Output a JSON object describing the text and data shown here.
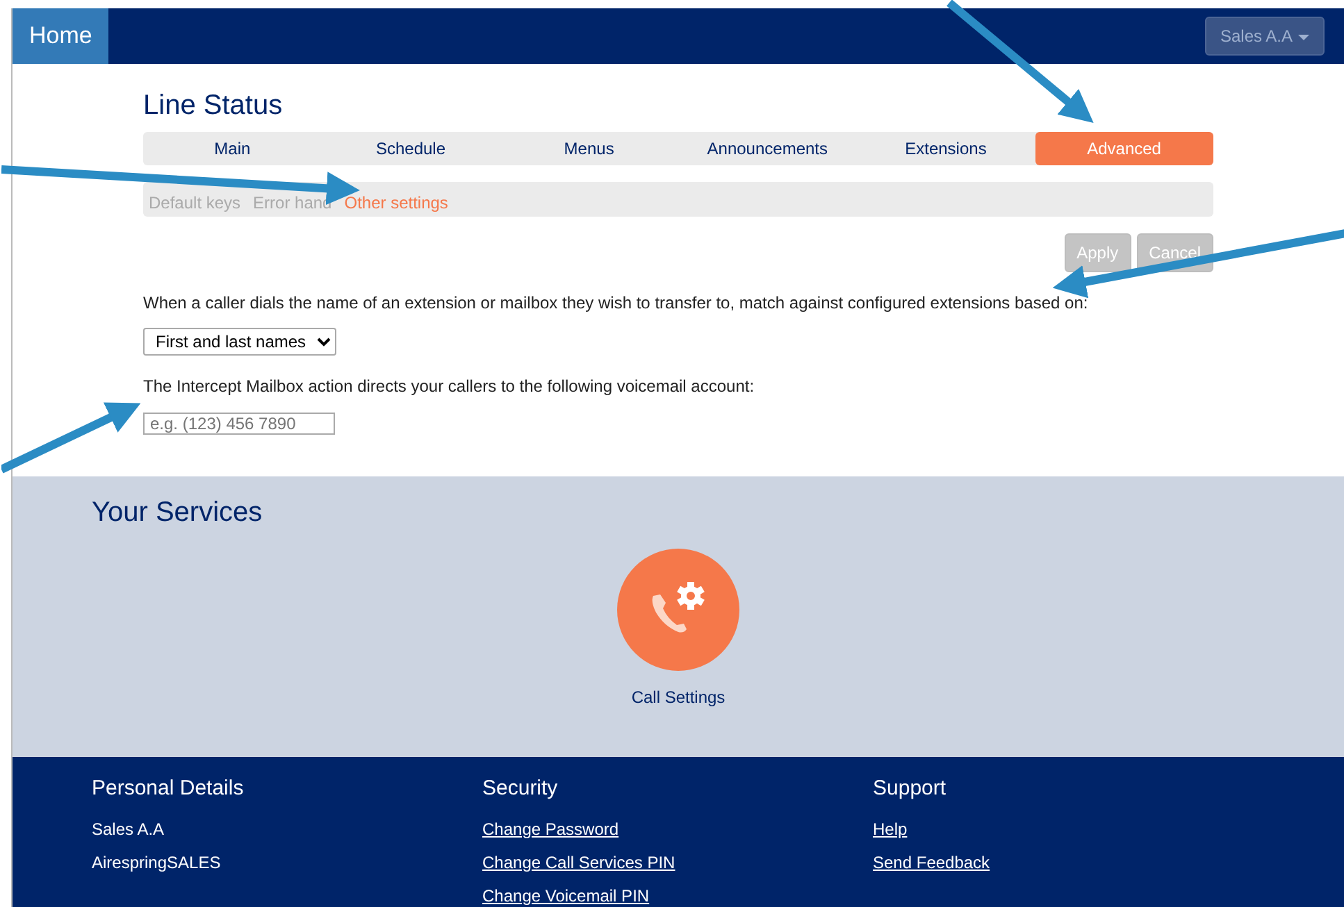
{
  "navbar": {
    "home": "Home",
    "user_menu": "Sales A.A"
  },
  "page_title": "Line Status",
  "tabs": [
    {
      "label": "Main",
      "selected": false
    },
    {
      "label": "Schedule",
      "selected": false
    },
    {
      "label": "Menus",
      "selected": false
    },
    {
      "label": "Announcements",
      "selected": false
    },
    {
      "label": "Extensions",
      "selected": false
    },
    {
      "label": "Advanced",
      "selected": true
    }
  ],
  "subtabs": [
    {
      "label": "Default keys",
      "selected": false
    },
    {
      "label": "Error hand",
      "selected": false
    },
    {
      "label": "Other settings",
      "selected": true
    }
  ],
  "actions": [
    {
      "label": "Apply",
      "disabled": true
    },
    {
      "label": "Cancel",
      "disabled": true
    }
  ],
  "settings": [
    {
      "kind": "select",
      "label": "When a caller dials the name of an extension or mailbox they wish to transfer to, match against configured extensions based on:",
      "value": "First and last names"
    },
    {
      "kind": "input",
      "label": "The Intercept Mailbox action directs your callers to the following voicemail account:",
      "placeholder": "e.g. (123) 456 7890"
    }
  ],
  "services": {
    "title": "Your Services",
    "items": [
      {
        "label": "Call Settings"
      }
    ]
  },
  "footer": [
    {
      "heading": "Personal Details",
      "items": [
        {
          "text": "Sales A.A",
          "kind": "text"
        },
        {
          "text": "AirespringSALES",
          "kind": "text"
        }
      ]
    },
    {
      "heading": "Security",
      "items": [
        {
          "text": "Change Password",
          "kind": "link"
        },
        {
          "text": "Change Call Services PIN",
          "kind": "link"
        },
        {
          "text": "Change Voicemail PIN",
          "kind": "link"
        }
      ]
    },
    {
      "heading": "Support",
      "items": [
        {
          "text": "Help",
          "kind": "link"
        },
        {
          "text": "Send Feedback",
          "kind": "link"
        }
      ]
    }
  ]
}
